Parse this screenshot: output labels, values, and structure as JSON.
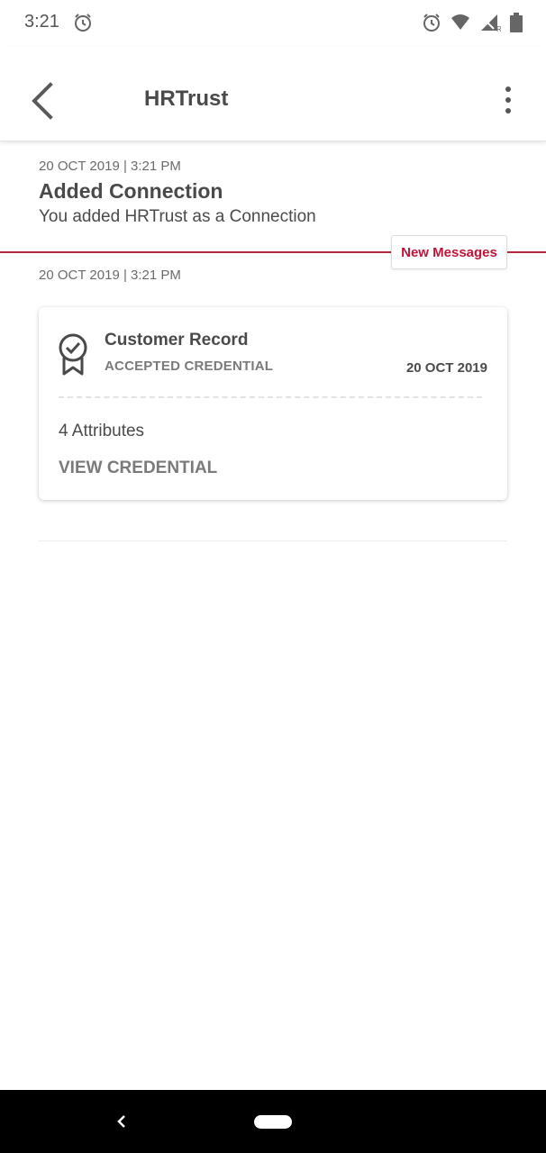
{
  "status_bar": {
    "time": "3:21",
    "icons": [
      "alarm-icon",
      "wifi-icon",
      "signal-icon",
      "battery-icon"
    ]
  },
  "app_bar": {
    "title": "HRTrust",
    "back_icon": "chevron-left-icon",
    "menu_icon": "more-vert-icon"
  },
  "event": {
    "timestamp": "20 OCT 2019 | 3:21 PM",
    "title": "Added Connection",
    "description": "You added HRTrust as a Connection"
  },
  "new_messages": {
    "label": "New Messages",
    "color": "#c2143a"
  },
  "message": {
    "timestamp": "20 OCT 2019 | 3:21 PM"
  },
  "credential_card": {
    "icon": "badge-check-icon",
    "title": "Customer Record",
    "subtitle": "ACCEPTED CREDENTIAL",
    "date": "20 OCT 2019",
    "attributes": "4 Attributes",
    "action_label": "VIEW CREDENTIAL"
  },
  "nav_bar": {
    "icons": [
      "back-triangle-icon",
      "home-pill-icon"
    ]
  }
}
